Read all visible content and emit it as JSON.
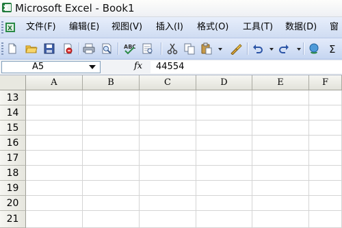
{
  "window": {
    "title": "Microsoft Excel - Book1"
  },
  "menubar": {
    "items": [
      "文件(F)",
      "编辑(E)",
      "视图(V)",
      "插入(I)",
      "格式(O)",
      "工具(T)",
      "数据(D)",
      "窗"
    ]
  },
  "toolbar": {
    "buttons": [
      "new-document-icon",
      "open-folder-icon",
      "save-icon",
      "permission-icon",
      "print-icon",
      "print-preview-icon",
      "spelling-icon",
      "research-icon",
      "cut-icon",
      "copy-icon",
      "paste-icon",
      "format-painter-icon",
      "undo-icon",
      "redo-icon",
      "hyperlink-icon",
      "autosum-icon"
    ]
  },
  "formula_bar": {
    "name_box": "A5",
    "fx_label": "fx",
    "value": "44554"
  },
  "sheet": {
    "columns": [
      "A",
      "B",
      "C",
      "D",
      "E",
      "F"
    ],
    "rows": [
      "13",
      "14",
      "15",
      "16",
      "17",
      "18",
      "19",
      "20",
      "21"
    ]
  },
  "colors": {
    "titlebar": "#eef0f4",
    "menubar": "#cfdcf2",
    "grid_line": "#d4d4d4",
    "header": "#e8e8e0"
  }
}
